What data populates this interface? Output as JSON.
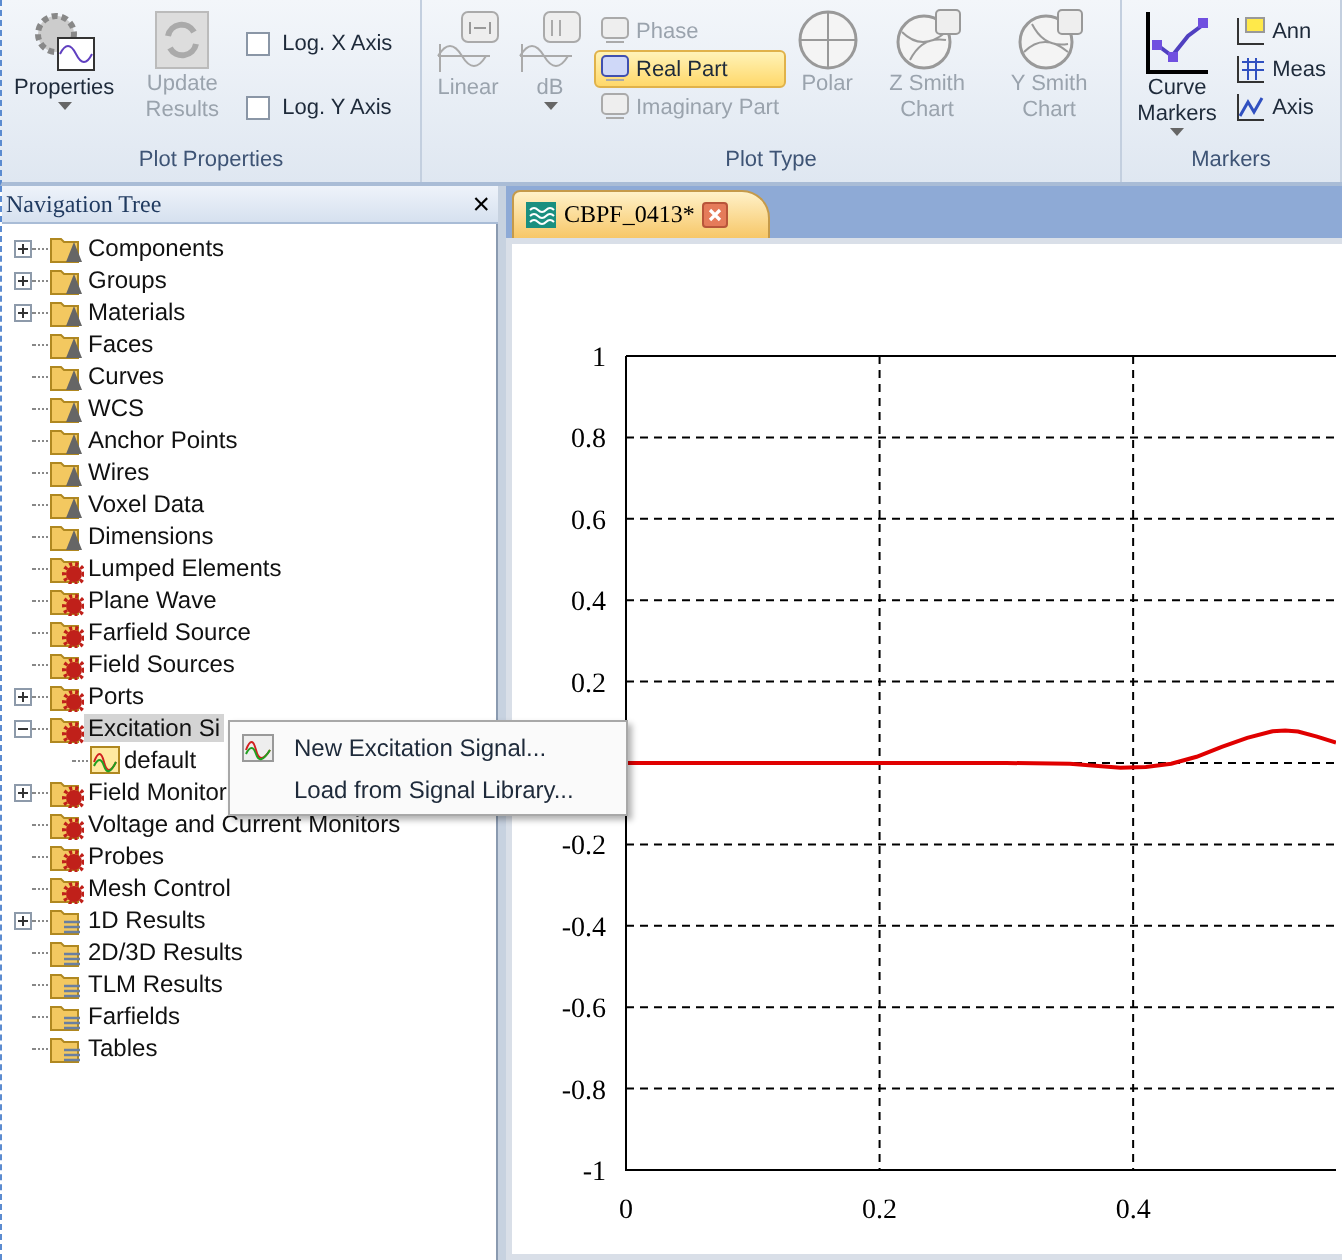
{
  "ribbon": {
    "groups": [
      {
        "label": "Plot Properties",
        "items": [
          {
            "kind": "large",
            "label": "Properties",
            "dropdown": true,
            "disabled": false
          },
          {
            "kind": "large",
            "label": "Update Results",
            "disabled": true
          },
          {
            "kind": "checks",
            "checks": [
              {
                "label": "Log. X Axis",
                "checked": false
              },
              {
                "label": "Log. Y Axis",
                "checked": false
              }
            ]
          }
        ]
      },
      {
        "label": "Plot Type",
        "items": [
          {
            "kind": "large",
            "label": "Linear",
            "disabled": true
          },
          {
            "kind": "large",
            "label": "dB",
            "dropdown": true,
            "disabled": true
          },
          {
            "kind": "smalls",
            "smalls": [
              {
                "label": "Phase",
                "disabled": true,
                "selected": false
              },
              {
                "label": "Real Part",
                "disabled": false,
                "selected": true
              },
              {
                "label": "Imaginary Part",
                "disabled": true,
                "selected": false
              }
            ]
          },
          {
            "kind": "large",
            "label": "Polar",
            "disabled": true
          },
          {
            "kind": "large",
            "label": "Z Smith Chart",
            "disabled": true
          },
          {
            "kind": "large",
            "label": "Y Smith Chart",
            "disabled": true
          }
        ]
      },
      {
        "label": "Markers",
        "items": [
          {
            "kind": "large",
            "label": "Curve Markers",
            "dropdown": true,
            "disabled": false
          },
          {
            "kind": "smalls",
            "smalls": [
              {
                "label": "Ann",
                "disabled": false,
                "selected": false
              },
              {
                "label": "Meas",
                "disabled": false,
                "selected": false
              },
              {
                "label": "Axis",
                "disabled": false,
                "selected": false
              }
            ]
          }
        ]
      }
    ]
  },
  "navigation_tree": {
    "title": "Navigation Tree",
    "close": "×",
    "items": [
      {
        "label": "Components",
        "kind": "plain",
        "expanded": false,
        "selected": false
      },
      {
        "label": "Groups",
        "kind": "plain",
        "expanded": false,
        "selected": false
      },
      {
        "label": "Materials",
        "kind": "plain",
        "expanded": false,
        "selected": false
      },
      {
        "label": "Faces",
        "kind": "plain",
        "selected": false
      },
      {
        "label": "Curves",
        "kind": "plain",
        "selected": false
      },
      {
        "label": "WCS",
        "kind": "plain",
        "selected": false
      },
      {
        "label": "Anchor Points",
        "kind": "plain",
        "selected": false
      },
      {
        "label": "Wires",
        "kind": "plain",
        "selected": false
      },
      {
        "label": "Voxel Data",
        "kind": "plain",
        "selected": false
      },
      {
        "label": "Dimensions",
        "kind": "plain",
        "selected": false
      },
      {
        "label": "Lumped Elements",
        "kind": "source",
        "selected": false
      },
      {
        "label": "Plane Wave",
        "kind": "source",
        "selected": false
      },
      {
        "label": "Farfield Source",
        "kind": "source",
        "selected": false
      },
      {
        "label": "Field Sources",
        "kind": "source",
        "selected": false
      },
      {
        "label": "Ports",
        "kind": "source",
        "expanded": false,
        "selected": false
      },
      {
        "label": "Excitation Si",
        "kind": "source",
        "expanded": true,
        "selected": true,
        "children": [
          {
            "label": "default",
            "kind": "signal",
            "selected": false
          }
        ]
      },
      {
        "label": "Field Monitor",
        "kind": "source",
        "expanded": false,
        "selected": false
      },
      {
        "label": "Voltage and Current Monitors",
        "kind": "source",
        "selected": false
      },
      {
        "label": "Probes",
        "kind": "source",
        "selected": false
      },
      {
        "label": "Mesh Control",
        "kind": "source",
        "selected": false
      },
      {
        "label": "1D Results",
        "kind": "result",
        "expanded": false,
        "selected": false
      },
      {
        "label": "2D/3D Results",
        "kind": "result",
        "selected": false
      },
      {
        "label": "TLM Results",
        "kind": "result",
        "selected": false
      },
      {
        "label": "Farfields",
        "kind": "result",
        "selected": false
      },
      {
        "label": "Tables",
        "kind": "result",
        "selected": false
      }
    ]
  },
  "context_menu": {
    "items": [
      {
        "label": "New Excitation Signal...",
        "kind": "signal"
      },
      {
        "label": "Load from Signal Library...",
        "kind": "plain"
      }
    ]
  },
  "document_tab": {
    "title": "CBPF_0413*",
    "selected": true
  },
  "plot": {
    "chart_data": {
      "type": "line",
      "x": [
        0,
        0.05,
        0.1,
        0.15,
        0.2,
        0.25,
        0.3,
        0.35,
        0.375,
        0.39,
        0.41,
        0.43,
        0.45,
        0.47,
        0.49,
        0.51,
        0.52,
        0.53,
        0.545,
        0.56
      ],
      "grid": true,
      "series": [
        {
          "color": "#e00000",
          "values": [
            0,
            0,
            0,
            0,
            0,
            0,
            0,
            -0.002,
            -0.008,
            -0.012,
            -0.01,
            -0.002,
            0.015,
            0.04,
            0.062,
            0.078,
            0.08,
            0.077,
            0.065,
            0.05
          ]
        }
      ],
      "xlim": [
        0,
        0.56
      ],
      "ylim": [
        -1,
        1
      ],
      "xticks": [
        0,
        0.2,
        0.4
      ],
      "yticks": [
        {
          "value": 1,
          "label": "1"
        },
        {
          "value": 0.8,
          "label": "0.8"
        },
        {
          "value": 0.6,
          "label": "0.6"
        },
        {
          "value": 0.4,
          "label": "0.4"
        },
        {
          "value": 0.2,
          "label": "0.2"
        },
        {
          "value": -0.2,
          "label": "-0.2"
        },
        {
          "value": -0.4,
          "label": "-0.4"
        },
        {
          "value": -0.6,
          "label": "-0.6"
        },
        {
          "value": -0.8,
          "label": "-0.8"
        },
        {
          "value": -1,
          "label": "-1"
        }
      ]
    }
  }
}
